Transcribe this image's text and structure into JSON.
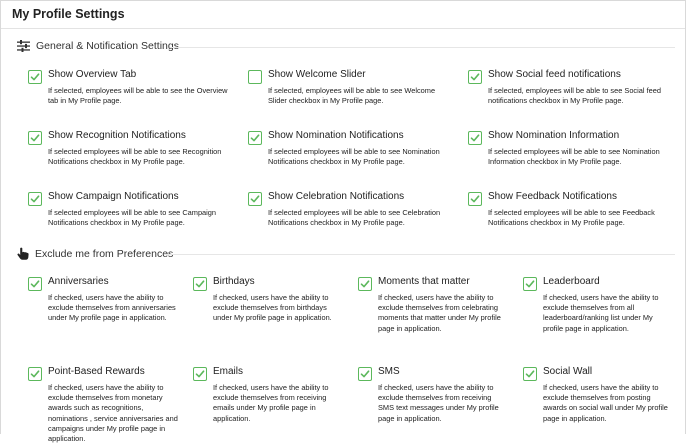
{
  "page": {
    "title": "My Profile Settings"
  },
  "sections": {
    "general": {
      "title": "General & Notification Settings",
      "items": [
        {
          "label": "Show Overview Tab",
          "checked": true,
          "desc": "If selected, employees will be able to see the Overview tab in My Profile page."
        },
        {
          "label": "Show Welcome Slider",
          "checked": false,
          "desc": "If selected, employees will be able to see Welcome Slider checkbox in My Profile page."
        },
        {
          "label": "Show Social feed notifications",
          "checked": true,
          "desc": "If selected, employees will be able to see Social feed notifications checkbox in My Profile page."
        },
        {
          "label": "Show Recognition Notifications",
          "checked": true,
          "desc": "If selected employees will be able to see Recognition Notifications checkbox in My Profile page."
        },
        {
          "label": "Show Nomination Notifications",
          "checked": true,
          "desc": "If selected employees will be able to see Nomination Notifications checkbox in My Profile page."
        },
        {
          "label": "Show Nomination Information",
          "checked": true,
          "desc": "If selected employees will be able to see Nomination Information checkbox in My Profile page."
        },
        {
          "label": "Show Campaign Notifications",
          "checked": true,
          "desc": "If selected employees will be able to see Campaign Notifications checkbox in My Profile page."
        },
        {
          "label": "Show Celebration Notifications",
          "checked": true,
          "desc": "If selected employees will be able to see Celebration Notifications checkbox in My Profile page."
        },
        {
          "label": "Show Feedback Notifications",
          "checked": true,
          "desc": "If selected employees will be able to see Feedback Notifications checkbox in My Profile page."
        }
      ]
    },
    "exclude": {
      "title": "Exclude me from Preferences",
      "items": [
        {
          "label": "Anniversaries",
          "checked": true,
          "desc": "If checked, users have the ability to exclude themselves from anniversaries under My profile page in application."
        },
        {
          "label": "Birthdays",
          "checked": true,
          "desc": "If checked, users have the ability to exclude themselves from birthdays under My profile page in application."
        },
        {
          "label": "Moments that matter",
          "checked": true,
          "desc": "If checked, users have the ability to exclude themselves from celebrating moments that matter under My profile page in application."
        },
        {
          "label": "Leaderboard",
          "checked": true,
          "desc": "If checked, users have the ability to exclude themselves from all leaderboard/ranking list under My profile page in application."
        },
        {
          "label": "Point-Based Rewards",
          "checked": true,
          "desc": "If checked, users have the ability to exclude themselves from monetary awards such as recognitions, nominations , service anniversaries and campaigns under My profile page in application."
        },
        {
          "label": "Emails",
          "checked": true,
          "desc": "If checked, users have the ability to exclude themselves from receiving emails under My profile page in application."
        },
        {
          "label": "SMS",
          "checked": true,
          "desc": "If checked, users have the ability to exclude themselves from receiving SMS text messages under My profile page in application."
        },
        {
          "label": "Social Wall",
          "checked": true,
          "desc": "If checked, users have the ability to exclude themselves from posting awards on social wall under My profile page in application."
        }
      ]
    }
  },
  "colors": {
    "checkbox": "#5cb85c",
    "text": "#222222"
  },
  "icons": {
    "general": "sliders-icon",
    "exclude": "hand-pointer-icon"
  }
}
